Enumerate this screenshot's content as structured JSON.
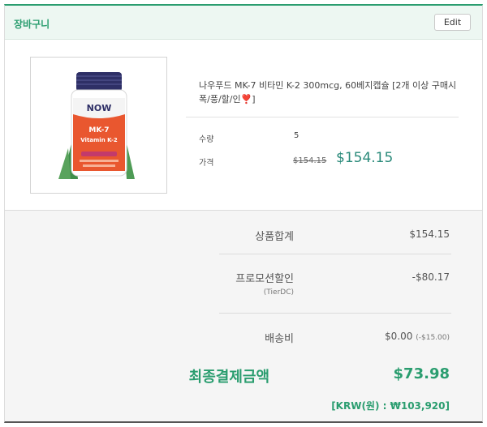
{
  "cart": {
    "title": "장바구니",
    "edit_label": "Edit"
  },
  "item": {
    "image_alt": "NOW MK-7 Vitamin K-2 bottle",
    "image_brand": "NOW",
    "image_line1": "MK-7",
    "image_line2": "Vitamin K-2",
    "name": "나우푸드 MK-7 비타민 K-2 300mcg, 60베지캡슐 [2개 이상 구매시 폭/풍/할/인❣️]",
    "qty_label": "수량",
    "qty_value": "5",
    "price_label": "가격",
    "original_price": "$154.15",
    "price": "$154.15"
  },
  "summary": {
    "subtotal_label": "상품합계",
    "subtotal_value": "$154.15",
    "promo_label": "프로모션할인",
    "promo_sub": "(TierDC)",
    "promo_value": "-$80.17",
    "shipping_label": "배송비",
    "shipping_value": "$0.00",
    "shipping_discount": "(-$15.00)",
    "final_label": "최종결제금액",
    "final_value": "$73.98",
    "krw": "[KRW(원) : ₩103,920]"
  },
  "colors": {
    "accent": "#2a9d6f",
    "price": "#2a8a7a",
    "header_bg": "#edf7f2"
  }
}
